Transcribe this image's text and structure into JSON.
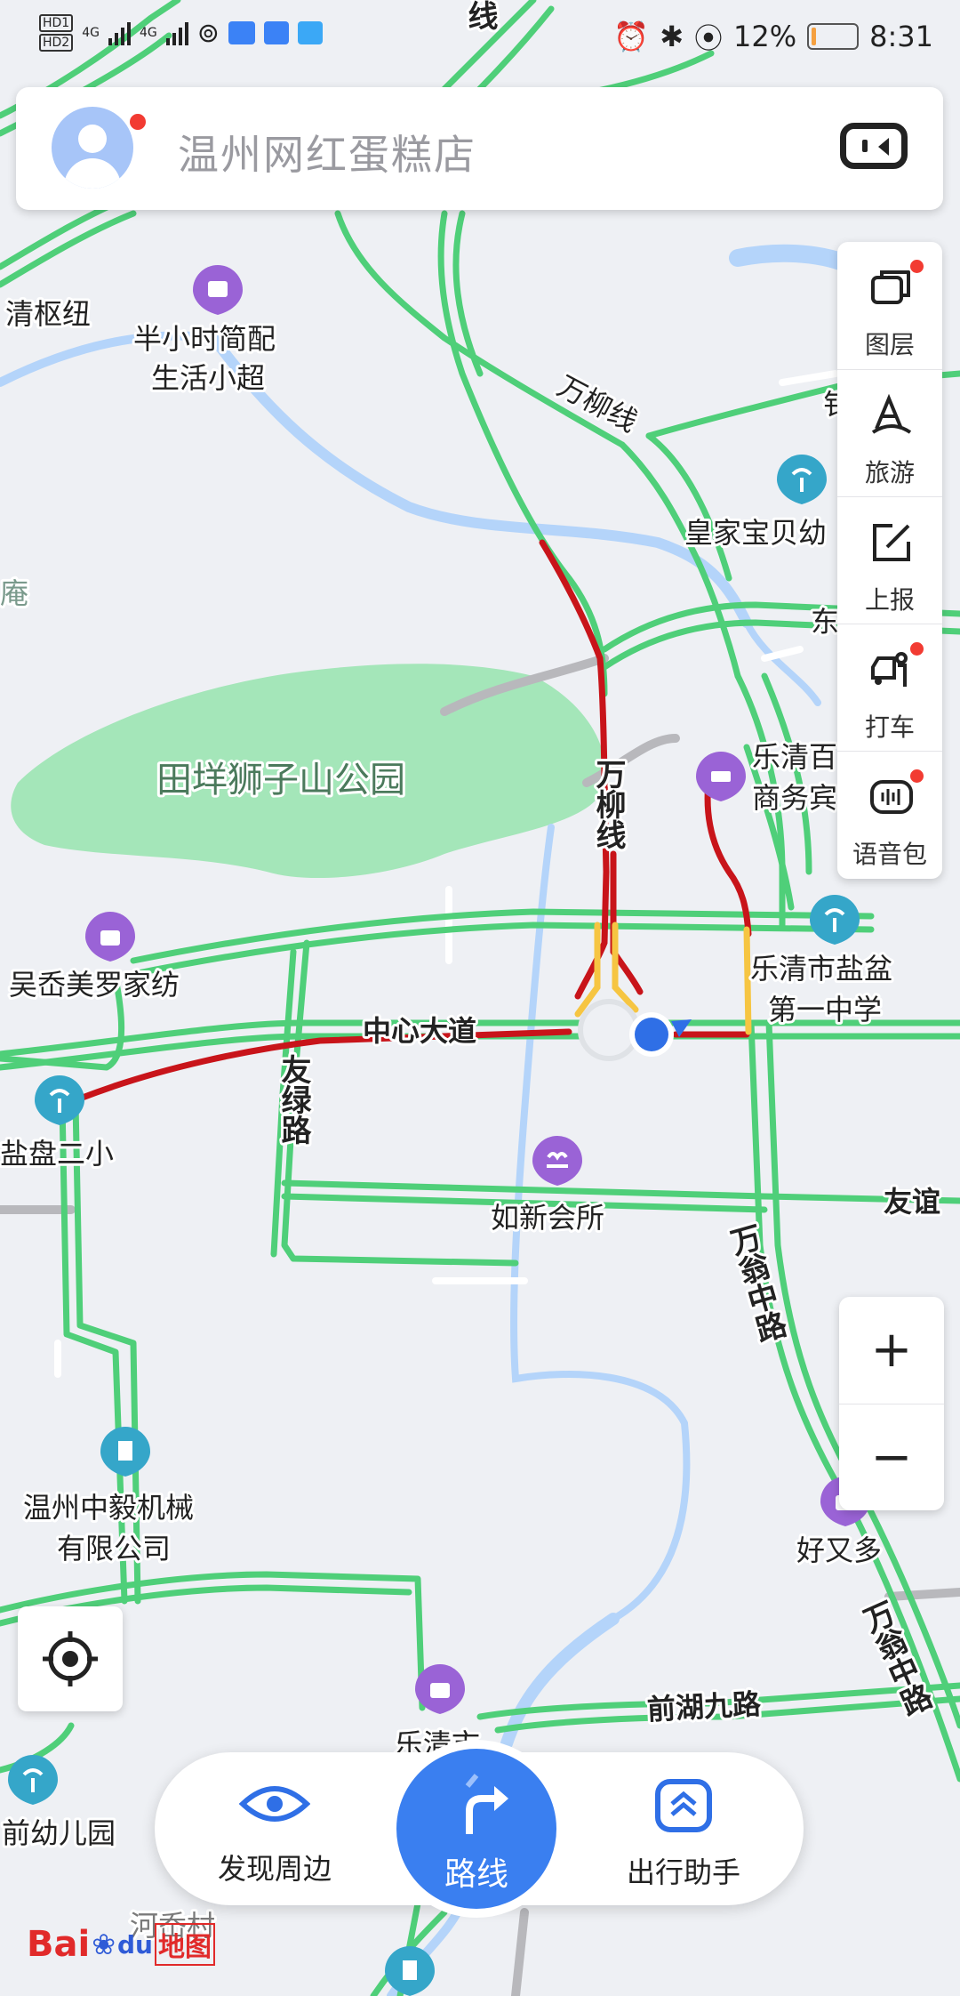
{
  "status_bar": {
    "hd1": "HD1",
    "hd2": "HD2",
    "net1": "4G",
    "net2": "4G",
    "battery_percent": "12%",
    "battery_level": 0.12,
    "time": "8:31"
  },
  "search": {
    "placeholder": "温州网红蛋糕店",
    "avatar_icon": "user-avatar-icon",
    "voice_icon": "voice-assistant-icon"
  },
  "right_panel": {
    "items": [
      {
        "label": "图层",
        "icon": "layers-icon",
        "has_dot": true
      },
      {
        "label": "旅游",
        "icon": "travel-icon",
        "has_dot": false
      },
      {
        "label": "上报",
        "icon": "report-icon",
        "has_dot": false
      },
      {
        "label": "打车",
        "icon": "taxi-icon",
        "has_dot": true
      },
      {
        "label": "语音包",
        "icon": "voice-pack-icon",
        "has_dot": true
      }
    ]
  },
  "zoom": {
    "in_label": "+",
    "out_label": "−"
  },
  "bottom_bar": {
    "discover_label": "发现周边",
    "route_label": "路线",
    "assistant_label": "出行助手"
  },
  "logo": {
    "bai": "Bai",
    "du": "du",
    "map": "地图"
  },
  "map": {
    "colors": {
      "road_green": "#4fcf79",
      "congested_red": "#c8141a",
      "slow_yellow": "#f6c542",
      "park": "#a4e6b9",
      "water": "#b4d4fa",
      "poi_purple": "#9a63d6",
      "poi_teal": "#35a6c9",
      "location_blue": "#2f6fe6"
    },
    "road_labels": [
      "万柳线",
      "万柳线",
      "中心大道",
      "友绿路",
      "万翁中路",
      "万翁中路",
      "前湖九路",
      "友谊",
      "东",
      "柳线"
    ],
    "place_labels": [
      "清枢纽",
      "田垟狮子山公园",
      "乐清百",
      "商务宾",
      "庵",
      "河岙村",
      "钅"
    ],
    "pois": [
      {
        "name": "半小时简配",
        "name2": "生活小超",
        "icon": "shopping-basket-icon"
      },
      {
        "name": "吴岙美罗家纺",
        "icon": "shopping-bag-icon"
      },
      {
        "name": "皇家宝贝幼",
        "icon": "tree-icon"
      },
      {
        "name": "乐清市盐盆",
        "name2": "第一中学",
        "icon": "tree-icon"
      },
      {
        "name": "盐盘二小",
        "icon": "tree-icon"
      },
      {
        "name": "如新会所",
        "icon": "hotspring-icon"
      },
      {
        "name": "温州中毅机械",
        "name2": "有限公司",
        "icon": "building-icon"
      },
      {
        "name": "好又多",
        "icon": "shopping-bag-icon"
      },
      {
        "name": "乐清市",
        "icon": "shopping-bag-icon"
      },
      {
        "name": "前幼儿园",
        "icon": "tree-icon"
      },
      {
        "name": "",
        "icon": "hotel-icon"
      }
    ]
  }
}
